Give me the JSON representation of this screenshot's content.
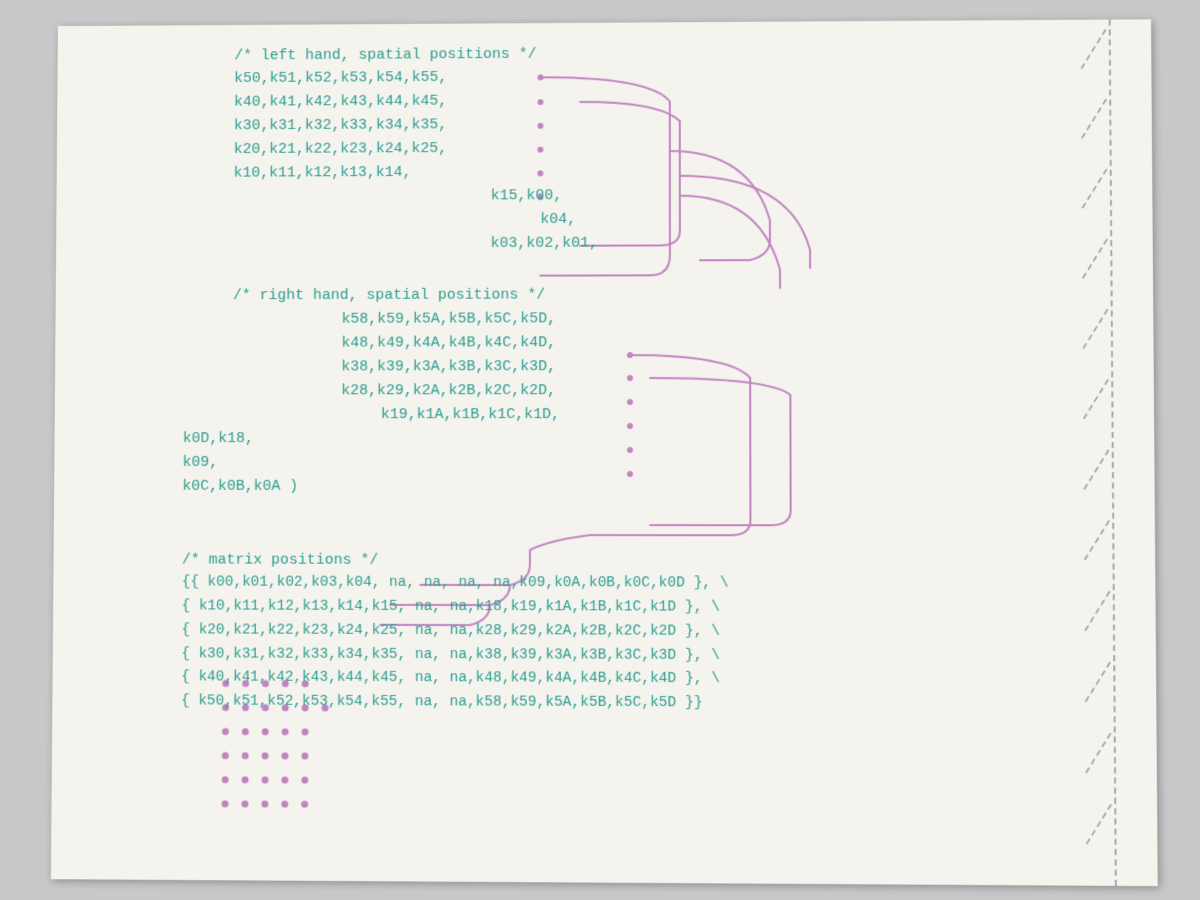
{
  "page": {
    "background": "#f5f3ee",
    "accent_color": "#c084c0",
    "teal_color": "#2a9d8f"
  },
  "left_hand": {
    "comment": "/* left hand, spatial positions */",
    "rows": [
      "k50,k51,k52,k53,k54,k55,",
      "k40,k41,k42,k43,k44,k45,",
      "k30,k31,k32,k33,k34,k35,",
      "k20,k21,k22,k23,k24,k25,",
      "k10,k11,k12,k13,k14,",
      "                              k15,k00,",
      "                                  k04,",
      "                              k03,k02,k01,"
    ]
  },
  "right_hand": {
    "comment": "/* right hand, spatial positions */",
    "rows": [
      "        k58,k59,k5A,k5B,k5C,k5D,",
      "        k48,k49,k4A,k4B,k4C,k4D,",
      "        k38,k39,k3A,k3B,k3C,k3D,",
      "        k28,k29,k2A,k2B,k2C,k2D,",
      "             k19,k1A,k1B,k1C,k1D,",
      "k0D,k18,",
      "k09,",
      "k0C,k0B,k0A )"
    ]
  },
  "matrix": {
    "comment": "/* matrix positions */",
    "rows": [
      "{{ k00,k01,k02,k03,k04,  na,  na,    na,  na,k09,k0A,k0B,k0C,k0D },",
      " { k10,k11,k12,k13,k14,k15,  na,    na,k18,k19,k1A,k1B,k1C,k1D },",
      " { k20,k21,k22,k23,k24,k25,  na,    na,k28,k29,k2A,k2B,k2C,k2D },",
      " { k30,k31,k32,k33,k34,k35,  na,    na,k38,k39,k3A,k3B,k3C,k3D },",
      " { k40,k41,k42,k43,k44,k45,  na,    na,k48,k49,k4A,k4B,k4C,k4D },",
      " { k50,k51,k52,k53,k54,k55,  na,    na,k58,k59,k5A,k5B,k5C,k5D }}"
    ]
  }
}
